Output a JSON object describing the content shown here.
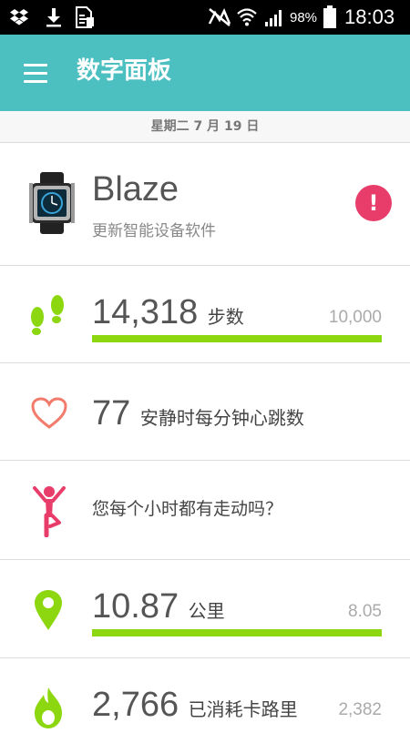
{
  "status_bar": {
    "battery": "98%",
    "time": "18:03",
    "icons": [
      "dropbox-icon",
      "download-icon",
      "document-icon",
      "mute-icon",
      "wifi-icon",
      "signal-icon",
      "battery-icon"
    ]
  },
  "app_bar": {
    "title": "数字面板"
  },
  "date": "星期二 7 月 19 日",
  "device": {
    "name": "Blaze",
    "status": "更新智能设备软件",
    "alert_symbol": "!"
  },
  "steps": {
    "value": "14,318",
    "unit": "步数",
    "goal": "10,000",
    "progress": 1.0
  },
  "heart": {
    "value": "77",
    "label": "安静时每分钟心跳数"
  },
  "hourly": {
    "text": "您每个小时都有走动吗？"
  },
  "distance": {
    "value": "10.87",
    "unit": "公里",
    "goal": "8.05",
    "progress": 1.0
  },
  "calories": {
    "value": "2,766",
    "unit": "已消耗卡路里",
    "goal": "2,382"
  },
  "colors": {
    "teal": "#4cbfc0",
    "green": "#8cd70f",
    "heart": "#f27b6c",
    "pink": "#e83d6a"
  }
}
